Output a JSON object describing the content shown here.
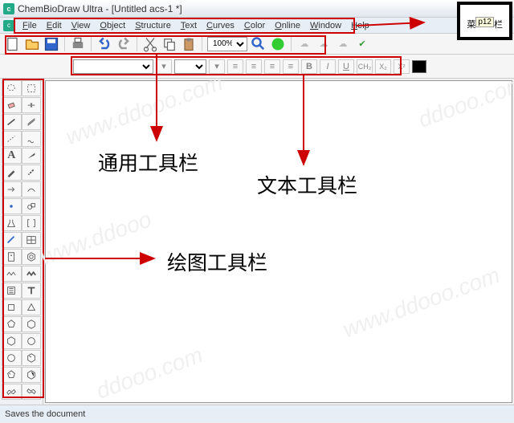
{
  "title": "ChemBioDraw Ultra - [Untitled acs-1 *]",
  "menu": {
    "file": "File",
    "edit": "Edit",
    "view": "View",
    "object": "Object",
    "structure": "Structure",
    "text": "Text",
    "curves": "Curves",
    "color": "Color",
    "online": "Online",
    "window": "Window",
    "help": "Help"
  },
  "toolbar1": {
    "zoom": "100%"
  },
  "toolbar2": {
    "bold": "B",
    "italic": "I",
    "underline": "U",
    "formula": "CH₂",
    "sub": "X₂",
    "sup": "X²"
  },
  "status": "Saves the document",
  "annotations": {
    "general_toolbar": "通用工具栏",
    "text_toolbar": "文本工具栏",
    "drawing_toolbar": "绘图工具栏",
    "menu_label_a": "菜",
    "menu_label_b": "栏",
    "menu_tip": "p12"
  },
  "tool_names": [
    "lasso",
    "marquee",
    "eraser",
    "fragment",
    "bond-solid",
    "bond-multi",
    "bond-dashed",
    "bond-wavy",
    "bond-wedge",
    "bond-hash",
    "text",
    "pen",
    "arrow",
    "orbital",
    "bracket",
    "chemical",
    "draw",
    "benzene",
    "acyclic",
    "chain",
    "template",
    "ring3",
    "ring4",
    "ring5",
    "ring6",
    "ring7",
    "cyclohex",
    "cyclohex2",
    "cyclopent",
    "cyclopent2",
    "benzene2",
    "ring8",
    "chair1",
    "chair2"
  ]
}
